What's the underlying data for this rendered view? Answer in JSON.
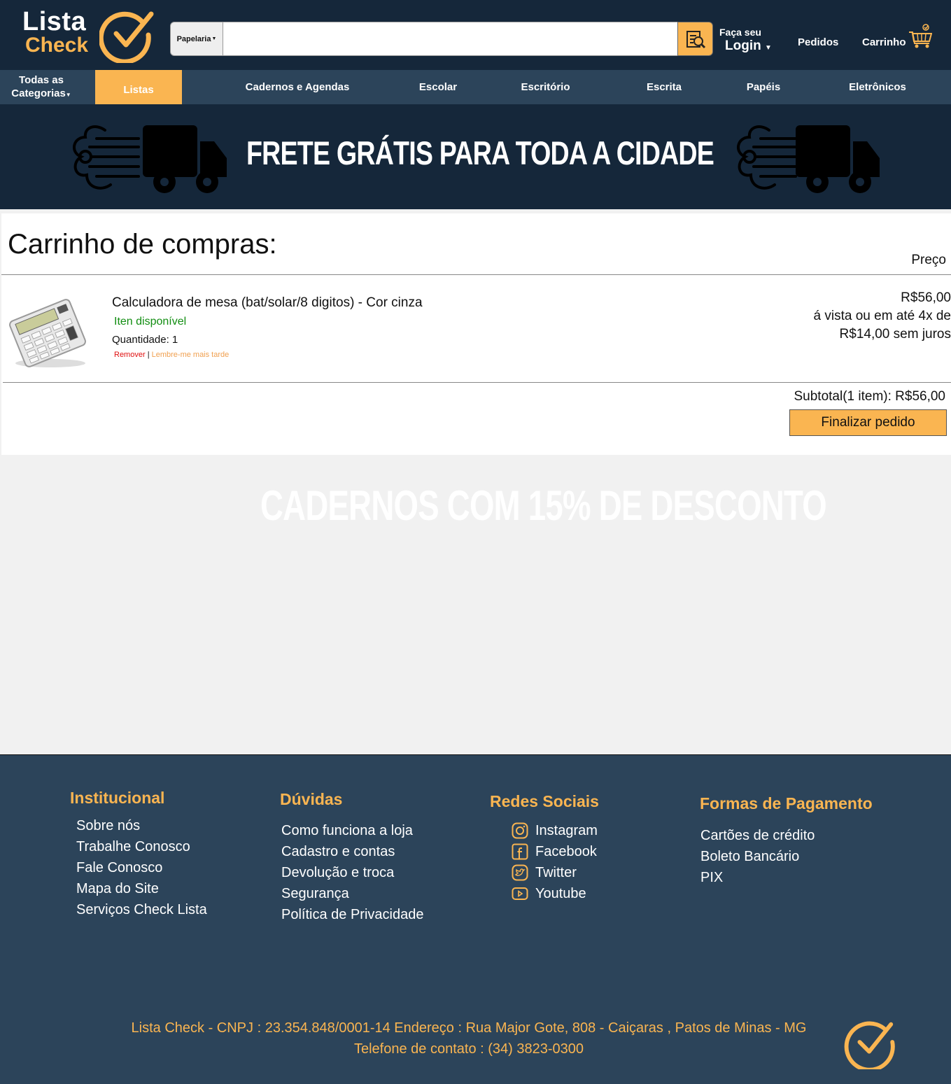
{
  "header": {
    "logo_line1": "Lista",
    "logo_line2": "Check",
    "search_category": "Papelaria",
    "search_placeholder": "",
    "login_small": "Faça seu",
    "login_big": "Login",
    "orders": "Pedidos",
    "cart": "Carrinho"
  },
  "nav": {
    "all_categories_line1": "Todas as",
    "all_categories_line2": "Categorias",
    "items": [
      "Listas",
      "Cadernos e Agendas",
      "Escolar",
      "Escritório",
      "Escrita",
      "Papéis",
      "Eletrônicos"
    ]
  },
  "banner": {
    "text": "FRETE GRÁTIS PARA TODA A CIDADE"
  },
  "cart": {
    "title": "Carrinho de compras:",
    "price_header": "Preço",
    "item": {
      "name": "Calculadora de mesa (bat/solar/8 digitos) - Cor cinza",
      "availability": "Iten disponível",
      "quantity": "Quantidade: 1",
      "remove": "Remover",
      "separator": "|",
      "save_later": "Lembre-me mais tarde",
      "price_line1": "R$56,00",
      "price_line2": "á vista ou em até 4x de",
      "price_line3": "R$14,00 sem juros"
    },
    "subtotal": "Subtotal(1 item): R$56,00",
    "checkout": "Finalizar pedido"
  },
  "promo": {
    "text": "CADERNOS COM 15% DE DESCONTO"
  },
  "footer": {
    "institucional": {
      "title": "Institucional",
      "links": [
        "Sobre nós",
        "Trabalhe Conosco",
        "Fale Conosco",
        "Mapa do Site",
        "Serviços Check Lista"
      ]
    },
    "duvidas": {
      "title": "Dúvidas",
      "links": [
        "Como funciona a loja",
        "Cadastro e contas",
        "Devolução e troca",
        "Segurança",
        "Política de Privacidade"
      ]
    },
    "redes": {
      "title": "Redes Sociais",
      "links": [
        "Instagram",
        "Facebook",
        "Twitter",
        "Youtube"
      ]
    },
    "pagamento": {
      "title": "Formas de Pagamento",
      "links": [
        "Cartões de crédito",
        "Boleto Bancário",
        "PIX"
      ]
    },
    "company_line": "Lista Check - CNPJ : 23.354.848/0001-14  Endereço : Rua Major Gote, 808 - Caiçaras , Patos de Minas - MG",
    "phone_line": "Telefone de contato : (34) 3823-0300"
  },
  "colors": {
    "dark_navy": "#15273a",
    "navy": "#2c445a",
    "accent": "#fab551"
  }
}
